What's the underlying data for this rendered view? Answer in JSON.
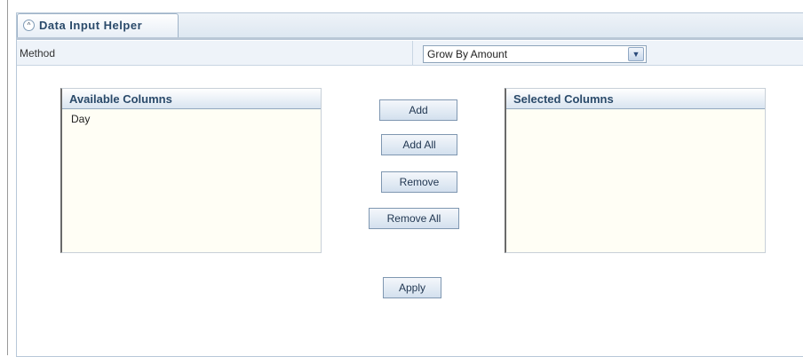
{
  "panel": {
    "title": "Data Input Helper",
    "icon": "collapse-up-icon"
  },
  "method": {
    "label": "Method",
    "selected": "Grow By Amount",
    "dropdown_icon": "chevron-down-icon"
  },
  "available_columns": {
    "title": "Available Columns",
    "items": [
      "Day"
    ]
  },
  "selected_columns": {
    "title": "Selected Columns",
    "items": []
  },
  "buttons": {
    "add": "Add",
    "add_all": "Add All",
    "remove": "Remove",
    "remove_all": "Remove All",
    "apply": "Apply"
  }
}
